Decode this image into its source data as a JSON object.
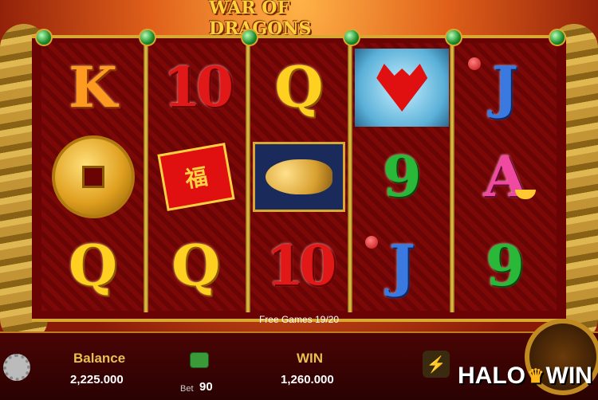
{
  "game": {
    "title": "WAR OF DRAGONS",
    "free_games_text": "Free Games 19/20"
  },
  "reels": [
    [
      {
        "symbol": "K",
        "style": "k"
      },
      {
        "symbol": "coin",
        "style": "coin"
      },
      {
        "symbol": "Q",
        "style": "q"
      }
    ],
    [
      {
        "symbol": "10",
        "style": "num10"
      },
      {
        "symbol": "red-envelope",
        "style": "envelope",
        "glyph": "福"
      },
      {
        "symbol": "Q",
        "style": "q"
      }
    ],
    [
      {
        "symbol": "Q",
        "style": "q"
      },
      {
        "symbol": "golden-fish",
        "style": "fish"
      },
      {
        "symbol": "10",
        "style": "num10"
      }
    ],
    [
      {
        "symbol": "dragon",
        "style": "dragon"
      },
      {
        "symbol": "9",
        "style": "nine"
      },
      {
        "symbol": "J",
        "style": "j"
      }
    ],
    [
      {
        "symbol": "J",
        "style": "j"
      },
      {
        "symbol": "A",
        "style": "a"
      },
      {
        "symbol": "9",
        "style": "nine"
      }
    ]
  ],
  "bottom": {
    "balance_label": "Balance",
    "balance_value": "2,225.000",
    "bet_label": "Bet",
    "bet_value": "90",
    "win_label": "WIN",
    "win_value": "1,260.000"
  },
  "branding": {
    "logo_left": "HALO",
    "logo_right": "WIN"
  },
  "colors": {
    "reel_background": "#6a0404",
    "frame_gold": "#d8a830",
    "label_gold": "#e8c050"
  }
}
